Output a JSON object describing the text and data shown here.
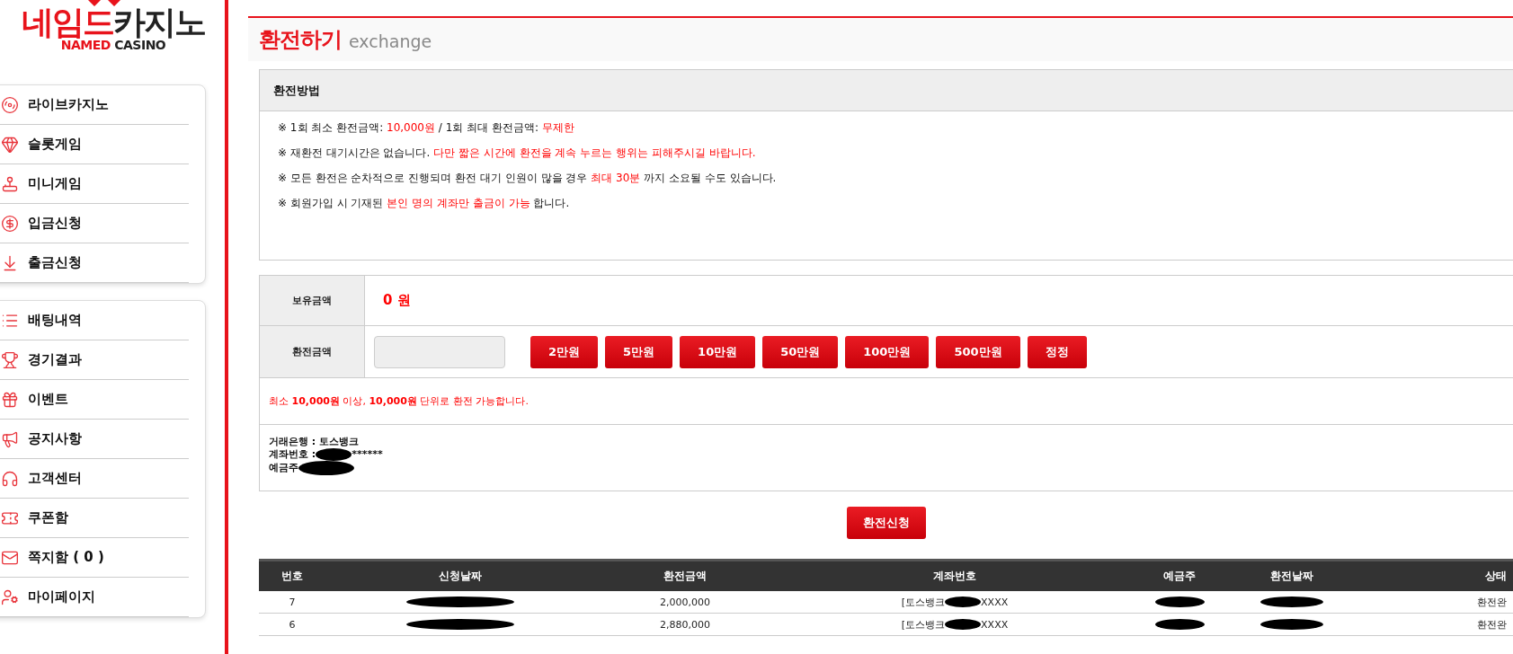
{
  "logo": {
    "parts": [
      {
        "text": "네임드",
        "accent": true
      },
      {
        "text": "카지노",
        "accent": false
      }
    ],
    "sub_parts": [
      {
        "text": "NAMED",
        "accent": true
      },
      {
        "text": "CASINO",
        "accent": false
      }
    ]
  },
  "sidebar": {
    "groups": [
      {
        "items": [
          {
            "label": "라이브카지노"
          },
          {
            "label": "슬롯게임"
          },
          {
            "label": "미니게임"
          },
          {
            "label": "입금신청"
          },
          {
            "label": "출금신청"
          }
        ]
      },
      {
        "items": [
          {
            "label": "배팅내역"
          },
          {
            "label": "경기결과"
          },
          {
            "label": "이벤트"
          },
          {
            "label": "공지사항"
          },
          {
            "label": "고객센터"
          },
          {
            "label": "쿠폰함"
          },
          {
            "label": "쪽지함 ( 0 )"
          },
          {
            "label": "마이페이지"
          }
        ]
      }
    ]
  },
  "page": {
    "title": "환전하기",
    "subtitle": "exchange"
  },
  "method": {
    "title": "환전방법",
    "notes": [
      [
        {
          "text": "※ 1회 최소 환전금액: ",
          "highlight": false
        },
        {
          "text": "10,000원",
          "highlight": true
        },
        {
          "text": " / 1회 최대 환전금액: ",
          "highlight": false
        },
        {
          "text": "무제한",
          "highlight": true
        }
      ],
      [
        {
          "text": "※ 재환전 대기시간은 없습니다. ",
          "highlight": false
        },
        {
          "text": "다만 짧은 시간에 환전을 계속 누르는 행위는 피해주시길 바랍니다.",
          "highlight": true
        }
      ],
      [
        {
          "text": "※ 모든 환전은 순차적으로 진행되며 환전 대기 인원이 많을 경우 ",
          "highlight": false
        },
        {
          "text": "최대 30분",
          "highlight": true
        },
        {
          "text": " 까지 소요될 수도 있습니다.",
          "highlight": false
        }
      ],
      [
        {
          "text": "※ 회원가입 시 기재된 ",
          "highlight": false
        },
        {
          "text": "본인 명의 계좌만 출금이 가능",
          "highlight": true
        },
        {
          "text": " 합니다.",
          "highlight": false
        }
      ]
    ]
  },
  "form": {
    "balance_label": "보유금액",
    "balance": "0 원",
    "amount_label": "환전금액",
    "amount_buttons": [
      "2만원",
      "5만원",
      "10만원",
      "50만원",
      "100만원",
      "500만원",
      "정정"
    ],
    "notice": "최소 **10,000원** 이상, **10,000원**  단위로 환전 가능합니다.",
    "bank": {
      "bank_line": "거래은행 : 토스뱅크",
      "account_label": "계좌번호 :",
      "account_tail": "******",
      "holder_label": "예금주"
    },
    "submit": "환전신청"
  },
  "table": {
    "columns": [
      "번호",
      "신청날짜",
      "환전금액",
      "계좌번호",
      "예금주",
      "환전날짜",
      "상태"
    ],
    "rows": [
      {
        "no": "7",
        "amount": "2,000,000",
        "account_head": "[토스뱅크",
        "account_tail": "XXXX",
        "status": "환전완"
      },
      {
        "no": "6",
        "amount": "2,880,000",
        "account_head": "[토스뱅크",
        "account_tail": "XXXX",
        "status": "환전완"
      }
    ]
  }
}
